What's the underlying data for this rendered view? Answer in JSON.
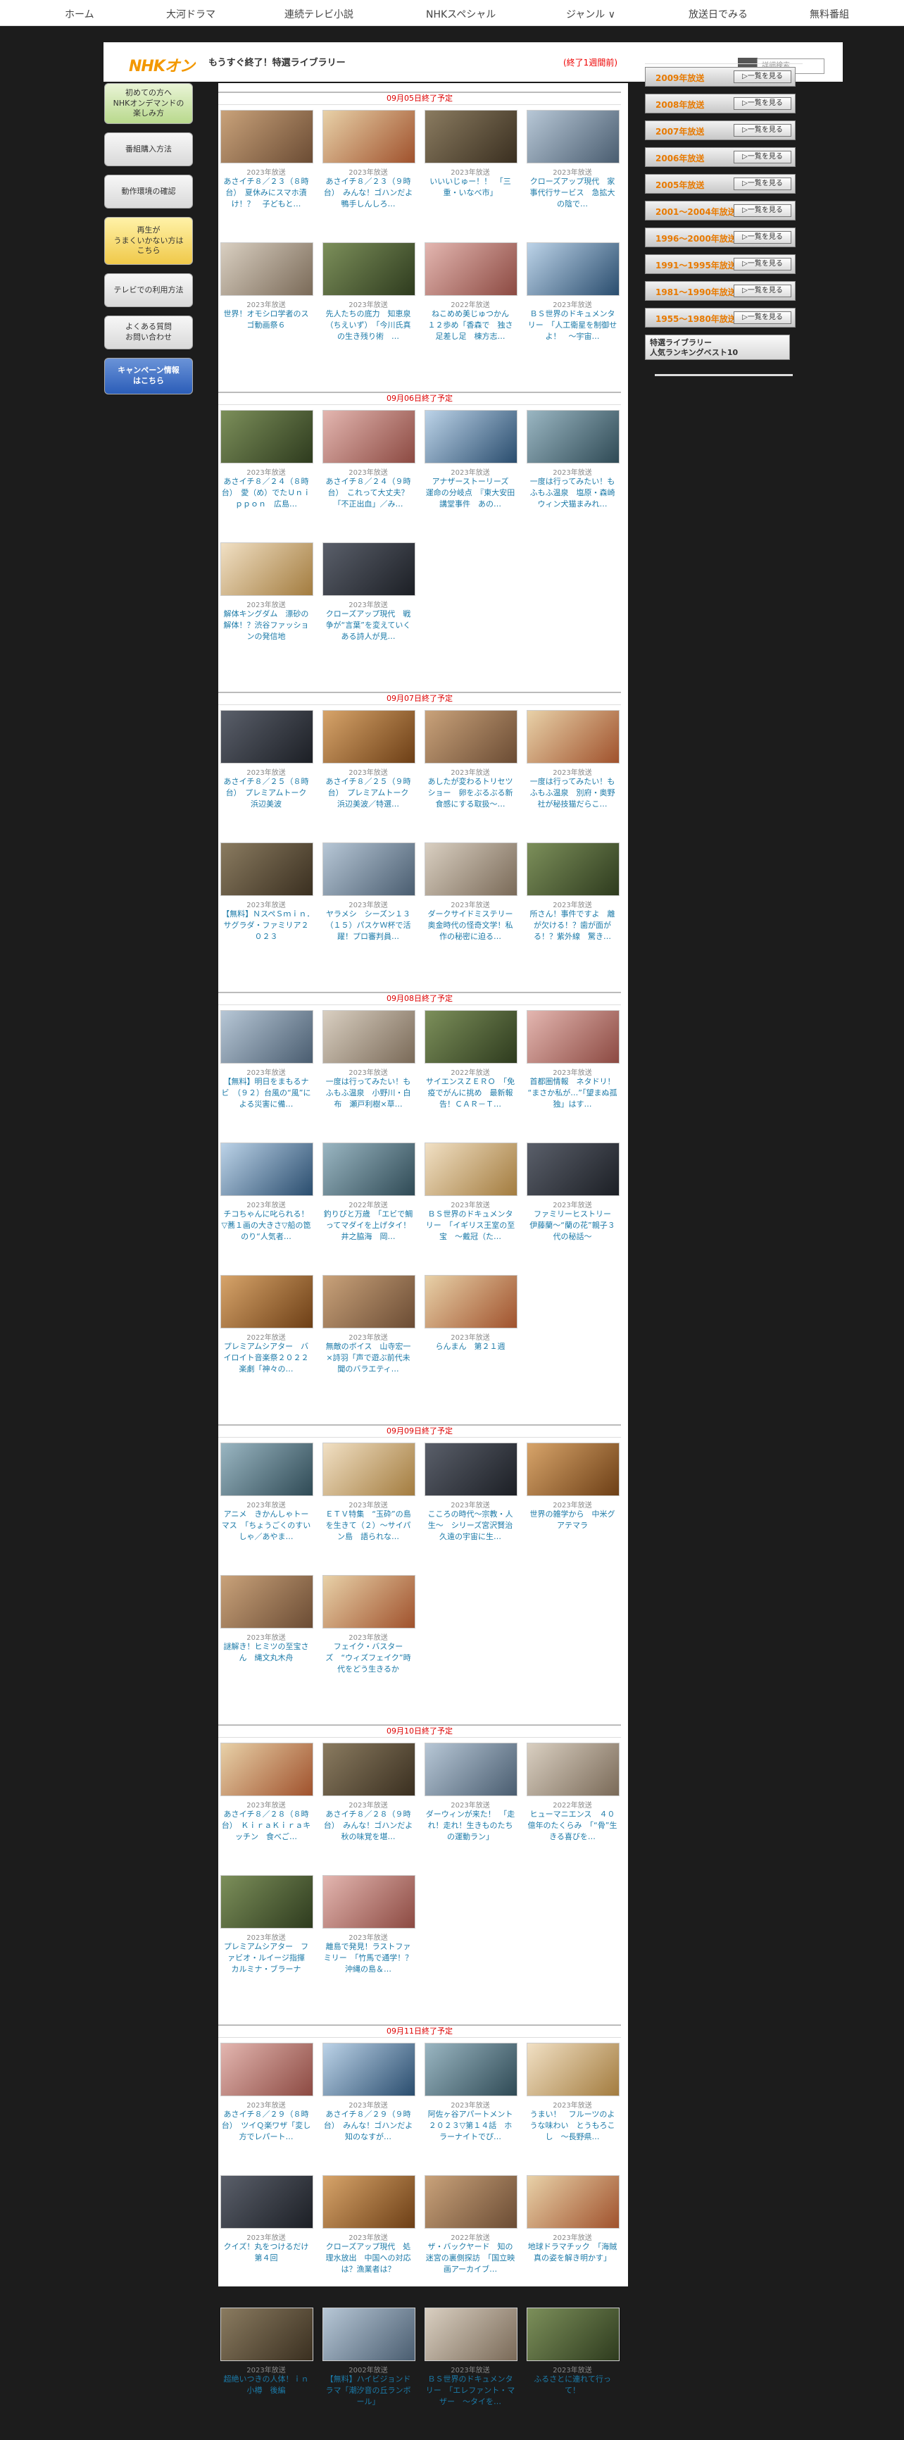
{
  "nav": [
    "ホーム",
    "大河ドラマ",
    "連続テレビ小説",
    "NHKスペシャル",
    "ジャンル ∨",
    "放送日でみる",
    "無料番組"
  ],
  "header": {
    "logo": "NHKオン",
    "title": "もうすぐ終了！特選ライブラリー",
    "note": "(終了1週間前)",
    "search_placeholder": "詳細検索"
  },
  "left_menu": [
    {
      "label": "初めての方へ\nNHKオンデマンドの\n楽しみ方",
      "style": "green",
      "h": 56
    },
    {
      "label": "番組購入方法",
      "style": "",
      "h": 46
    },
    {
      "label": "動作環境の確認",
      "style": "",
      "h": 46
    },
    {
      "label": "再生が\nうまくいかない方は\nこちら",
      "style": "yellow",
      "h": 66
    },
    {
      "label": "テレビでの利用方法",
      "style": "",
      "h": 46
    },
    {
      "label": "よくある質問\nお問い合わせ",
      "style": "",
      "h": 46
    },
    {
      "label": "キャンペーン情報\nはこちら",
      "style": "blue",
      "h": 50
    }
  ],
  "right_menu": {
    "years": [
      "2009年放送",
      "2008年放送",
      "2007年放送",
      "2006年放送",
      "2005年放送",
      "2001～2004年放送",
      "1996～2000年放送",
      "1991～1995年放送",
      "1981～1990年放送",
      "1955～1980年放送"
    ],
    "button_label": "一覧を見る",
    "ranking_title": "特選ライブラリー\n人気ランキングベスト10"
  },
  "sections": [
    {
      "date": "09月05日終了予定",
      "cards": [
        {
          "year": "2023年放送",
          "title": "あさイチ８／２３（８時台）　夏休みにスマホ漬け！？　子どもと…"
        },
        {
          "year": "2023年放送",
          "title": "あさイチ８／２３（９時台）　みんな！ゴハンだよ　鴨手しんしろ…"
        },
        {
          "year": "2023年放送",
          "title": "いいいじゅー！！　「三重・いなべ市」"
        },
        {
          "year": "2023年放送",
          "title": "クローズアップ現代　家事代行サービス　急拡大の陰で…"
        },
        {
          "year": "2023年放送",
          "title": "世界！オモシロ学者のスゴ動画祭６"
        },
        {
          "year": "2023年放送",
          "title": "先人たちの底力　知恵泉（ちえいず）　「今川氏真の生き残り術　…"
        },
        {
          "year": "2022年放送",
          "title": "ねこめめ美じゅつかん　１２歩め「香森で　独さ足差し足　棟方志…"
        },
        {
          "year": "2023年放送",
          "title": "ＢＳ世界のドキュメンタリー　「人工衛星を制御せよ！　～宇宙…"
        }
      ]
    },
    {
      "date": "09月06日終了予定",
      "cards": [
        {
          "year": "2023年放送",
          "title": "あさイチ８／２４（８時台）　愛（め）でたＵｎｉｐｐｏｎ　広島…"
        },
        {
          "year": "2023年放送",
          "title": "あさイチ８／２４（９時台）　これって大丈夫？「不正出血」／み…"
        },
        {
          "year": "2023年放送",
          "title": "アナザーストーリーズ　運命の分岐点　『東大安田講堂事件　あの…"
        },
        {
          "year": "2023年放送",
          "title": "一度は行ってみたい！もふもふ温泉　塩原・森崎ウィン犬猫まみれ…"
        },
        {
          "year": "2023年放送",
          "title": "解体キングダム　漂砂の解体！？渋谷ファッションの発信地"
        },
        {
          "year": "2023年放送",
          "title": "クローズアップ現代　戦争が“言葉”を変えていく　ある詩人が見…"
        }
      ]
    },
    {
      "date": "09月07日終了予定",
      "cards": [
        {
          "year": "2023年放送",
          "title": "あさイチ８／２５（８時台）　プレミアムトーク　浜辺美波"
        },
        {
          "year": "2023年放送",
          "title": "あさイチ８／２５（９時台）　プレミアムトーク　浜辺美波／特選…"
        },
        {
          "year": "2023年放送",
          "title": "あしたが変わるトリセツショー　卵をぶるぶる新食感にする取扱～…"
        },
        {
          "year": "2023年放送",
          "title": "一度は行ってみたい！もふもふ温泉　別府・奥野社が秘技猫だらこ…"
        },
        {
          "year": "2023年放送",
          "title": "【無料】ＮスペＳｍｉｎ．　サグラダ・ファミリア２０２３"
        },
        {
          "year": "2023年放送",
          "title": "ヤラメシ　シーズン１３　（１５）パスケＷ杯で活躍！プロ審判員…"
        },
        {
          "year": "2023年放送",
          "title": "ダークサイドミステリー　奥金時代の怪奇文学！私作の秘密に迫る…"
        },
        {
          "year": "2023年放送",
          "title": "所さん！事件ですよ　離が欠ける！？歯が面がる！？紫外線　驚き…"
        }
      ]
    },
    {
      "date": "09月08日終了予定",
      "cards": [
        {
          "year": "2023年放送",
          "title": "【無料】明日をまもるナビ　（９２）台風の“風”による災害に備…"
        },
        {
          "year": "2023年放送",
          "title": "一度は行ってみたい！もふもふ温泉　小野川・白布　瀬戸利樹×草…"
        },
        {
          "year": "2022年放送",
          "title": "サイエンスＺＥＲＯ　「免疫でがんに挑め　最新報告！ＣＡＲ－Ｔ…"
        },
        {
          "year": "2023年放送",
          "title": "首都圏情報　ネタドリ！　“まさか私が…”「望まぬ孤独」はす…"
        },
        {
          "year": "2023年放送",
          "title": "チコちゃんに叱られる！　▽蕎１画の大きさ▽船の箆のり“人気者…"
        },
        {
          "year": "2022年放送",
          "title": "釣りびと万歳　「エビで鯛ってマダイを上げタイ！　井之脇海　岡…"
        },
        {
          "year": "2023年放送",
          "title": "ＢＳ世界のドキュメンタリー　「イギリス王室の至宝　～戴冠（た…"
        },
        {
          "year": "2023年放送",
          "title": "ファミリーヒストリー　伊藤蘭～“蘭の花”親子３代の秘話～"
        },
        {
          "year": "2022年放送",
          "title": "プレミアムシアター　バイロイト音楽祭２０２２　楽劇「神々の…"
        },
        {
          "year": "2023年放送",
          "title": "無敵のボイス　山寺宏一×詩羽「声で遊ぶ前代未聞のバラエティ…"
        },
        {
          "year": "2023年放送",
          "title": "らんまん　第２１週"
        }
      ]
    },
    {
      "date": "09月09日終了予定",
      "cards": [
        {
          "year": "2023年放送",
          "title": "アニメ　きかんしゃトーマス　「ちょうごくのすいしゃ／あやま…"
        },
        {
          "year": "2023年放送",
          "title": "ＥＴＶ特集　“玉砕”の島を生きて（２）～サイパン島　語られな…"
        },
        {
          "year": "2023年放送",
          "title": "こころの時代～宗教・人生～　シリーズ宮沢賢治　久遠の宇宙に生…"
        },
        {
          "year": "2023年放送",
          "title": "世界の雑学から　中米グアテマラ"
        },
        {
          "year": "2023年放送",
          "title": "謎解き！ヒミツの至宝さん　縄文丸木舟"
        },
        {
          "year": "2023年放送",
          "title": "フェイク・バスターズ　“ウィズフェイク”時代をどう生きるか"
        }
      ]
    },
    {
      "date": "09月10日終了予定",
      "cards": [
        {
          "year": "2023年放送",
          "title": "あさイチ８／２８（８時台）　ＫｉｒａＫｉｒａキッチン　食べご…"
        },
        {
          "year": "2023年放送",
          "title": "あさイチ８／２８（９時台）　みんな！ゴハンだよ　秋の味覚を堪…"
        },
        {
          "year": "2023年放送",
          "title": "ダーウィンが来た！　「走れ！走れ！生きものたちの運動ラン」"
        },
        {
          "year": "2022年放送",
          "title": "ヒューマニエンス　４０億年のたくらみ　「“骨”生きる喜びを…"
        },
        {
          "year": "2023年放送",
          "title": "プレミアムシアター　ファビオ・ルイージ指揮　カルミナ・ブラーナ"
        },
        {
          "year": "2023年放送",
          "title": "離島で発見！ラストファミリー　「竹馬で通学！？沖縄の島＆…"
        }
      ]
    },
    {
      "date": "09月11日終了予定",
      "cards": [
        {
          "year": "2023年放送",
          "title": "あさイチ８／２９（８時台）　ツイＱ楽ワザ「変し方でレパート…"
        },
        {
          "year": "2023年放送",
          "title": "あさイチ８／２９（９時台）　みんな！ゴハンだよ　知のなすが…"
        },
        {
          "year": "2023年放送",
          "title": "阿佐ヶ谷アパートメント　２０２３▽第１４話　ホラーナイトでぴ…"
        },
        {
          "year": "2023年放送",
          "title": "うまい！　フルーツのような味わい　とうもろこし　～長野県…"
        },
        {
          "year": "2023年放送",
          "title": "クイズ！丸をつけるだけ　第４回"
        },
        {
          "year": "2023年放送",
          "title": "クローズアップ現代　処理水放出　中国への対応は？漁業者は？"
        },
        {
          "year": "2022年放送",
          "title": "ザ・バックヤード　知の迷宮の裏側探訪　「国立映画アーカイブ…"
        },
        {
          "year": "2023年放送",
          "title": "地球ドラマチック　「海賊　真の姿を解き明かす」"
        },
        {
          "year": "2023年放送",
          "title": "超絶いつきの人体！ｉｎ小樽　後編"
        },
        {
          "year": "2002年放送",
          "title": "【無料】ハイビジョンドラマ「潮汐音の丘ランボール」"
        },
        {
          "year": "2023年放送",
          "title": "ＢＳ世界のドキュメンタリー　「エレファント・マザー　～タイを…"
        },
        {
          "year": "2023年放送",
          "title": "ふるさとに連れて行って！"
        }
      ]
    }
  ]
}
